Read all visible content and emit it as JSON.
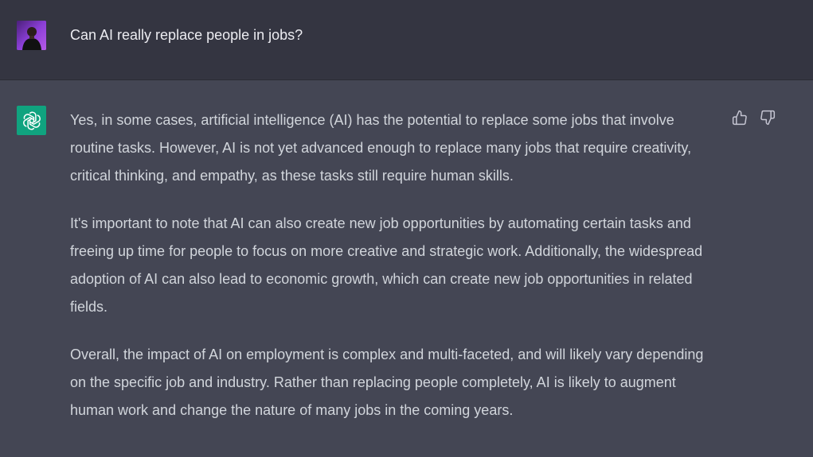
{
  "conversation": {
    "user_message": {
      "avatar_icon": "user-avatar",
      "text": "Can AI really replace people in jobs?"
    },
    "assistant_message": {
      "logo_icon": "openai-logo-icon",
      "paragraphs": [
        "Yes, in some cases, artificial intelligence (AI) has the potential to replace some jobs that involve routine tasks. However, AI is not yet advanced enough to replace many jobs that require creativity, critical thinking, and empathy, as these tasks still require human skills.",
        "It's important to note that AI can also create new job opportunities by automating certain tasks and freeing up time for people to focus on more creative and strategic work. Additionally, the widespread adoption of AI can also lead to economic growth, which can create new job opportunities in related fields.",
        "Overall, the impact of AI on employment is complex and multi-faceted, and will likely vary depending on the specific job and industry. Rather than replacing people completely, AI is likely to augment human work and change the nature of many jobs in the coming years."
      ],
      "feedback": {
        "thumbs_up_icon": "thumbs-up-icon",
        "thumbs_down_icon": "thumbs-down-icon"
      }
    }
  },
  "colors": {
    "user_row_bg": "#343541",
    "assistant_row_bg": "#444654",
    "logo_bg": "#10a37f",
    "text": "#d1d5db"
  }
}
